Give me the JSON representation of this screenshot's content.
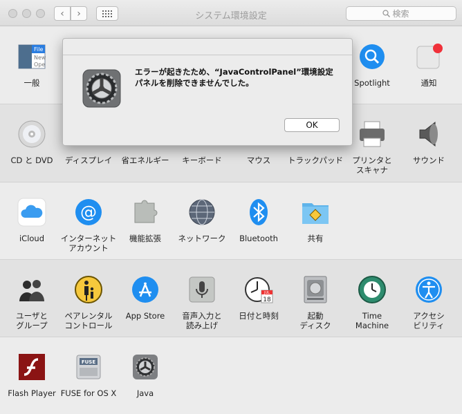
{
  "window": {
    "title": "システム環境設定",
    "nav_back": "‹",
    "nav_forward": "›",
    "search_placeholder": "検索"
  },
  "sections": {
    "row1": [
      {
        "id": "general",
        "label": "一般",
        "icon": "general-icon"
      },
      {
        "id": "spotlight",
        "label": "Spotlight",
        "icon": "spotlight-icon"
      },
      {
        "id": "notifications",
        "label": "通知",
        "icon": "notifications-icon"
      }
    ],
    "row2": [
      {
        "id": "cd-dvd",
        "label": "CD と DVD",
        "icon": "cd-icon"
      },
      {
        "id": "display",
        "label": "ディスプレイ",
        "icon": "display-icon"
      },
      {
        "id": "energy",
        "label": "省エネルギー",
        "icon": "energy-icon"
      },
      {
        "id": "keyboard",
        "label": "キーボード",
        "icon": "keyboard-icon"
      },
      {
        "id": "mouse",
        "label": "マウス",
        "icon": "mouse-icon"
      },
      {
        "id": "trackpad",
        "label": "トラックパッド",
        "icon": "trackpad-icon"
      },
      {
        "id": "printers",
        "label": "プリンタと\nスキャナ",
        "icon": "printer-icon"
      },
      {
        "id": "sound",
        "label": "サウンド",
        "icon": "speaker-icon"
      }
    ],
    "row3": [
      {
        "id": "icloud",
        "label": "iCloud",
        "icon": "cloud-icon"
      },
      {
        "id": "internet-accounts",
        "label": "インターネット\nアカウント",
        "icon": "at-icon"
      },
      {
        "id": "extensions",
        "label": "機能拡張",
        "icon": "puzzle-icon"
      },
      {
        "id": "network",
        "label": "ネットワーク",
        "icon": "globe-icon"
      },
      {
        "id": "bluetooth",
        "label": "Bluetooth",
        "icon": "bluetooth-icon"
      },
      {
        "id": "sharing",
        "label": "共有",
        "icon": "sharing-folder-icon"
      }
    ],
    "row4": [
      {
        "id": "users",
        "label": "ユーザと\nグループ",
        "icon": "users-icon"
      },
      {
        "id": "parental",
        "label": "ペアレンタル\nコントロール",
        "icon": "parental-icon"
      },
      {
        "id": "app-store",
        "label": "App Store",
        "icon": "app-store-icon"
      },
      {
        "id": "dictation",
        "label": "音声入力と\n読み上げ",
        "icon": "microphone-icon"
      },
      {
        "id": "date-time",
        "label": "日付と時刻",
        "icon": "clock-icon"
      },
      {
        "id": "startup-disk",
        "label": "起動\nディスク",
        "icon": "disk-icon"
      },
      {
        "id": "time-machine",
        "label": "Time\nMachine",
        "icon": "time-machine-icon"
      },
      {
        "id": "accessibility",
        "label": "アクセシ\nビリティ",
        "icon": "accessibility-icon"
      }
    ],
    "row5": [
      {
        "id": "flash",
        "label": "Flash Player",
        "icon": "flash-icon"
      },
      {
        "id": "fuse",
        "label": "FUSE for OS X",
        "icon": "fuse-icon"
      },
      {
        "id": "java",
        "label": "Java",
        "icon": "java-gear-icon"
      }
    ]
  },
  "icon_text": {
    "general_file": "File",
    "general_new": "New",
    "general_open": "Ope",
    "calendar_month": "JUL",
    "calendar_day": "18",
    "fuse_badge": "FUSE"
  },
  "dialog": {
    "message": "エラーが起きたため、“JavaControlPanel”環境設定パネルを削除できませんでした。",
    "ok_label": "OK",
    "icon": "system-preferences-gear-icon"
  },
  "colors": {
    "accent_blue": "#1f8ef0",
    "notification_badge": "#f0313a"
  }
}
